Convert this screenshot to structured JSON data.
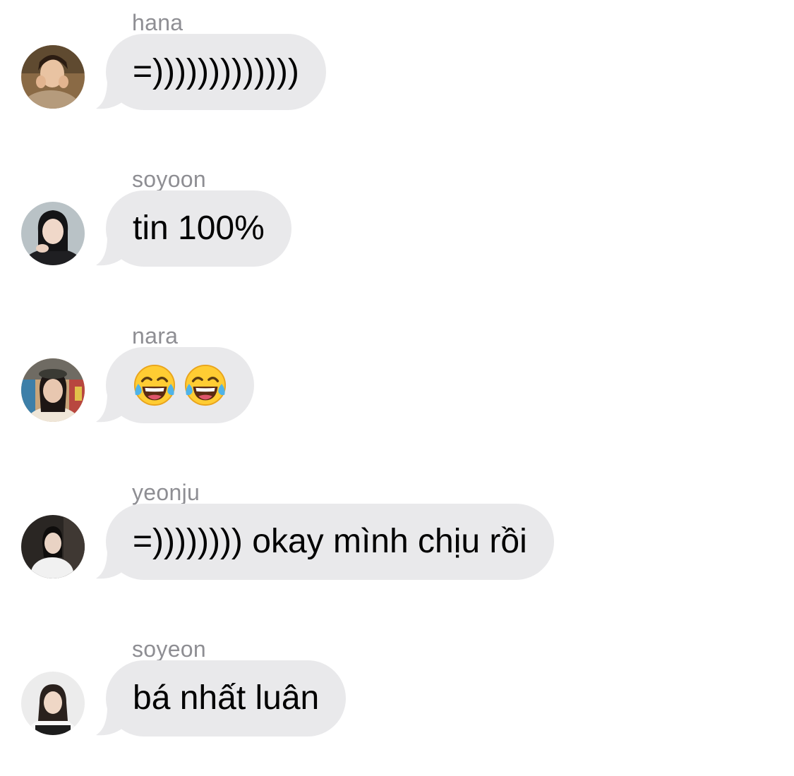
{
  "conversation": {
    "messages": [
      {
        "sender": "hana",
        "text": "=)))))))))))))",
        "avatar": "profile-photo-hana"
      },
      {
        "sender": "soyoon",
        "text": "tin 100%",
        "avatar": "profile-photo-soyoon"
      },
      {
        "sender": "nara",
        "text": "",
        "emojis": [
          "face-with-tears-of-joy-icon",
          "face-with-tears-of-joy-icon"
        ],
        "avatar": "profile-photo-nara"
      },
      {
        "sender": "yeonju",
        "text": "=)))))))) okay mình chịu rồi",
        "avatar": "profile-photo-yeonju"
      },
      {
        "sender": "soyeon",
        "text": "bá nhất luân",
        "avatar": "profile-photo-soyeon"
      }
    ]
  },
  "colors": {
    "bubble_background": "#e9e9eb",
    "sender_name": "#8e8e93",
    "message_text": "#000000",
    "page_background": "#ffffff"
  }
}
